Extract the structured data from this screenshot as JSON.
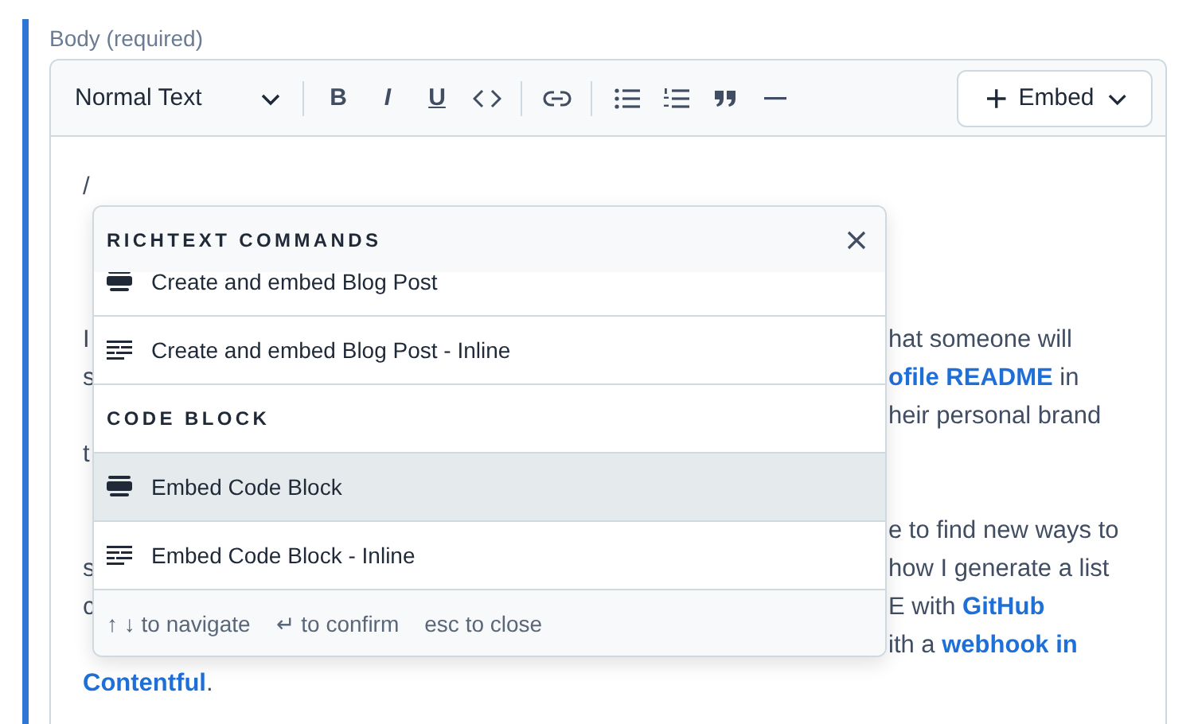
{
  "field": {
    "label": "Body (required)"
  },
  "toolbar": {
    "text_style": "Normal Text",
    "format_buttons": [
      {
        "glyph": "B",
        "kind": "bold"
      },
      {
        "glyph": "I",
        "kind": "italic"
      },
      {
        "glyph": "U",
        "kind": "underline"
      }
    ],
    "embed_button": "Embed"
  },
  "editor": {
    "command_text": "/",
    "paragraphs": [
      {
        "lines": [
          {
            "left": [
              {
                "text": "I",
                "kind": "text"
              }
            ],
            "right": [
              {
                "text": "hat someone will",
                "kind": "text"
              }
            ]
          },
          {
            "left": [
              {
                "text": "s",
                "kind": "text"
              }
            ],
            "right": [
              {
                "text": "ofile README",
                "kind": "link"
              },
              {
                "text": " in",
                "kind": "text"
              }
            ]
          },
          {
            "right": [
              {
                "text": "heir personal brand",
                "kind": "text"
              }
            ]
          },
          {
            "left": [
              {
                "text": "t",
                "kind": "text"
              }
            ]
          }
        ]
      },
      {
        "lines": [
          {
            "right": [
              {
                "text": "e to find new ways to",
                "kind": "text"
              }
            ]
          },
          {
            "left": [
              {
                "text": "s",
                "kind": "text"
              }
            ],
            "right": [
              {
                "text": "how I generate a list",
                "kind": "text"
              }
            ]
          },
          {
            "left": [
              {
                "text": "c",
                "kind": "text"
              }
            ],
            "right": [
              {
                "text": "E with ",
                "kind": "text"
              },
              {
                "text": "GitHub",
                "kind": "link"
              }
            ]
          },
          {
            "right": [
              {
                "text": "ith a ",
                "kind": "text"
              },
              {
                "text": "webhook in",
                "kind": "link"
              }
            ]
          },
          {
            "left": [
              {
                "text": "Contentful",
                "kind": "link"
              },
              {
                "text": ".",
                "kind": "text"
              }
            ]
          }
        ]
      }
    ]
  },
  "popup": {
    "sections": [
      {
        "title": "RICHTEXT COMMANDS",
        "items": [
          {
            "label": "Create and embed Blog Post",
            "kind": "block",
            "selected": false
          },
          {
            "label": "Create and embed Blog Post - Inline",
            "kind": "inline",
            "selected": false
          }
        ]
      },
      {
        "title": "CODE BLOCK",
        "items": [
          {
            "label": "Embed Code Block",
            "kind": "block",
            "selected": true
          },
          {
            "label": "Embed Code Block - Inline",
            "kind": "inline",
            "selected": false
          }
        ]
      }
    ],
    "hints": [
      "↑ ↓ to navigate",
      "↵ to confirm",
      "esc to close"
    ]
  }
}
